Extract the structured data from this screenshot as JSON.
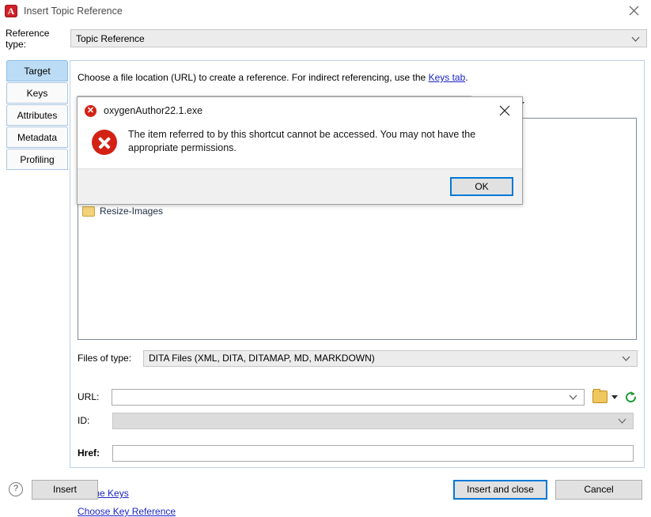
{
  "window": {
    "title": "Insert Topic Reference",
    "logo_letter": "A",
    "logo_color": "#cf2027",
    "close_icon": "close-icon"
  },
  "reference_type": {
    "label": "Reference type:",
    "value": "Topic Reference",
    "arrow_icon": "chevron-down-icon"
  },
  "tabs": [
    {
      "label": "Target",
      "selected": true
    },
    {
      "label": "Keys",
      "selected": false
    },
    {
      "label": "Attributes",
      "selected": false
    },
    {
      "label": "Metadata",
      "selected": false
    },
    {
      "label": "Profiling",
      "selected": false
    }
  ],
  "main": {
    "hint_prefix": "Choose a file location (URL) to create a reference. For indirect referencing, use the ",
    "hint_link": "Keys tab",
    "hint_suffix": ".",
    "toolbar": {
      "up_folder_icon": "up-one-level-icon",
      "view_mode_icon": "view-mode-icon",
      "view_mode_caret": "chevron-down-icon"
    },
    "file_list": [
      {
        "name": "Resize-Images",
        "icon": "folder-icon"
      }
    ],
    "files_of_type": {
      "label": "Files of type:",
      "value": "DITA Files (XML, DITA, DITAMAP, MD, MARKDOWN)",
      "arrow_icon": "chevron-down-icon"
    },
    "url": {
      "label": "URL:",
      "value": "",
      "arrow_icon": "chevron-down-icon",
      "browse_icon": "folder-open-icon",
      "browse_caret": "caret-down-icon",
      "refresh_icon": "refresh-icon",
      "refresh_color": "#1c9c33"
    },
    "id": {
      "label": "ID:",
      "value": "",
      "disabled": true,
      "arrow_icon": "chevron-down-icon"
    },
    "href": {
      "label": "Href:",
      "value": ""
    },
    "links": {
      "define_keys": "Define Keys",
      "choose_key_reference": "Choose Key Reference",
      "color": "#1a24c8"
    }
  },
  "footer": {
    "help_icon": "help-icon",
    "help_glyph": "?",
    "insert": "Insert",
    "insert_and_close": "Insert and close",
    "cancel": "Cancel",
    "focus_color": "#0078d7"
  },
  "error_dialog": {
    "title": "oxygenAuthor22.1.exe",
    "title_icon": "error-icon",
    "title_glyph": "✕",
    "close_icon": "close-icon",
    "close_glyph": "✕",
    "body_icon": "error-icon",
    "message": "The item referred to by this shortcut cannot be accessed. You may not have the appropriate permissions.",
    "ok": "OK",
    "error_color": "#d32215",
    "focus_color": "#0078d7"
  }
}
